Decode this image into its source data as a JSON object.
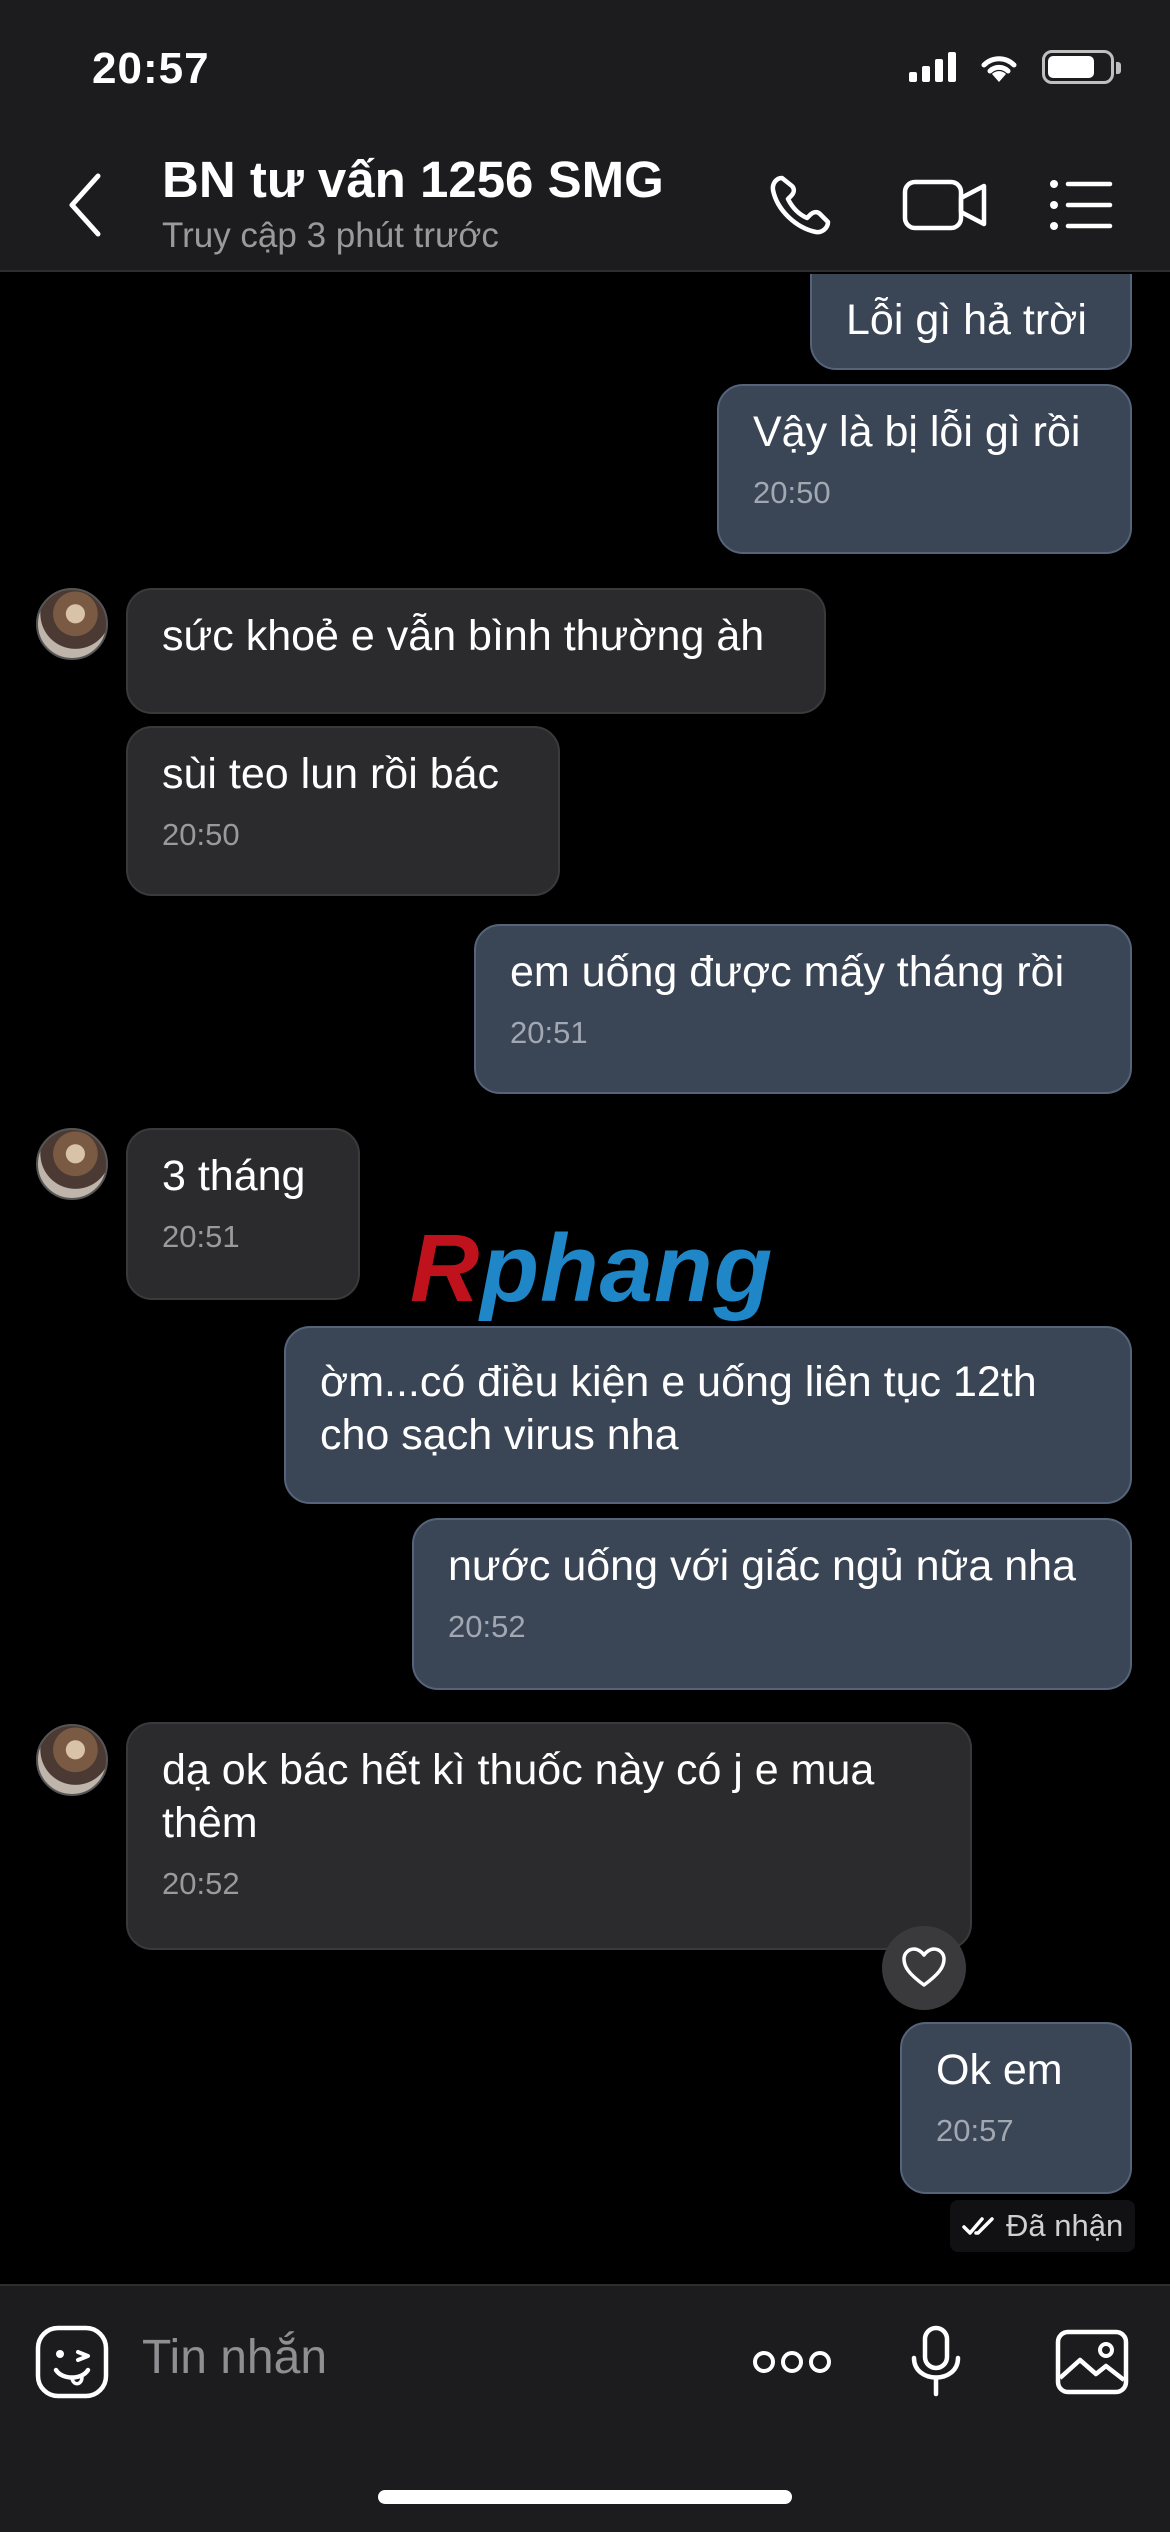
{
  "status_bar": {
    "time": "20:57",
    "icons": [
      "cellular-signal-icon",
      "wifi-icon",
      "battery-icon"
    ]
  },
  "header": {
    "title": "BN tư vấn 1256 SMG",
    "subtitle": "Truy cập 3 phút trước",
    "icons": [
      "back-chevron-icon",
      "phone-call-icon",
      "video-call-icon",
      "menu-list-icon"
    ]
  },
  "messages": [
    {
      "side": "out",
      "text": "Lỗi gì hả trời"
    },
    {
      "side": "out",
      "text": "Vậy là bị lỗi gì rồi",
      "time": "20:50"
    },
    {
      "side": "in",
      "text": "sức khoẻ e vẫn bình thường àh"
    },
    {
      "side": "in",
      "text": "sùi teo lun rồi bác",
      "time": "20:50"
    },
    {
      "side": "out",
      "text": "em uống được mấy tháng rồi",
      "time": "20:51"
    },
    {
      "side": "in",
      "text": "3 tháng",
      "time": "20:51"
    },
    {
      "side": "out",
      "text": "ờm...có điều kiện e uống liên tục 12th",
      "text2": "cho sạch virus nha"
    },
    {
      "side": "out",
      "text": "nước uống với giấc ngủ nữa nha",
      "time": "20:52"
    },
    {
      "side": "in",
      "text": "dạ ok bác hết kì thuốc này có j e mua",
      "text2": "thêm",
      "time": "20:52"
    },
    {
      "side": "out",
      "text": "Ok em",
      "time": "20:57"
    }
  ],
  "watermark": {
    "first": "R",
    "rest": "phang"
  },
  "read_receipt": "Đã nhận",
  "composer": {
    "placeholder": "Tin nhắn",
    "icons": [
      "sticker-icon",
      "more-icon",
      "microphone-icon",
      "gallery-icon"
    ]
  },
  "colors": {
    "outgoing_bubble": "#3a4556",
    "incoming_bubble": "#2b2b2d",
    "background": "#000000",
    "bar": "#1c1c1e"
  }
}
